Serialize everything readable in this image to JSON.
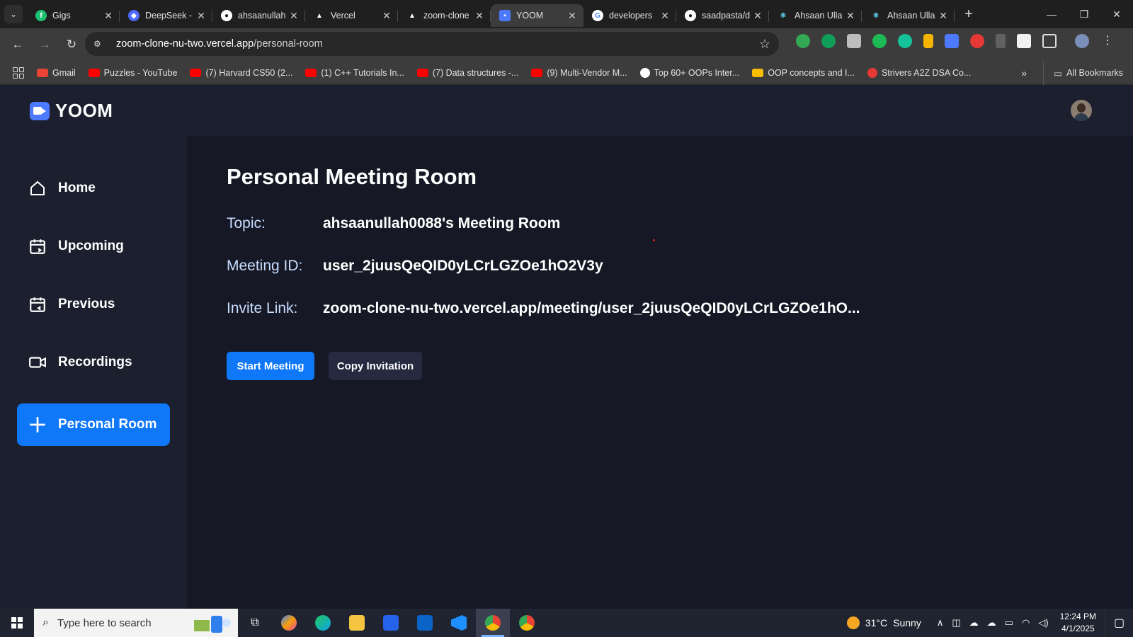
{
  "browser": {
    "tabs": [
      {
        "title": "Gigs",
        "icon": "fiverr-icon",
        "color": "#1dbf73"
      },
      {
        "title": "DeepSeek -",
        "icon": "deepseek-icon",
        "color": "#4d6bfe"
      },
      {
        "title": "ahsaanullah",
        "icon": "github-icon",
        "color": "#ffffff"
      },
      {
        "title": "Vercel",
        "icon": "vercel-icon",
        "color": "#ffffff"
      },
      {
        "title": "zoom-clone",
        "icon": "vercel-icon",
        "color": "#ffffff"
      },
      {
        "title": "YOOM",
        "icon": "yoom-icon",
        "color": "#4d79ff"
      },
      {
        "title": "developers",
        "icon": "google-icon",
        "color": "#ffffff"
      },
      {
        "title": "saadpasta/d",
        "icon": "github-icon",
        "color": "#ffffff"
      },
      {
        "title": "Ahsaan Ulla",
        "icon": "react-icon",
        "color": "#61dafb"
      },
      {
        "title": "Ahsaan Ulla",
        "icon": "react-icon",
        "color": "#61dafb"
      }
    ],
    "url_host": "zoom-clone-nu-two.vercel.app",
    "url_path": "/personal-room",
    "bookmarks": [
      {
        "label": "Gmail",
        "color": "#ea4335"
      },
      {
        "label": "Puzzles - YouTube",
        "color": "#ff0000"
      },
      {
        "label": "(7) Harvard CS50 (2...",
        "color": "#ff0000"
      },
      {
        "label": "(1) C++ Tutorials In...",
        "color": "#ff0000"
      },
      {
        "label": "(7) Data structures -...",
        "color": "#ff0000"
      },
      {
        "label": "(9) Multi-Vendor M...",
        "color": "#ff0000"
      },
      {
        "label": "Top 60+ OOPs Inter...",
        "color": "#ffffff"
      },
      {
        "label": "OOP concepts and I...",
        "color": "#fbbc04"
      },
      {
        "label": "Strivers A2Z DSA Co...",
        "color": "#e53935"
      }
    ],
    "all_bookmarks": "All Bookmarks"
  },
  "app": {
    "logo_text": "YOOM",
    "sidebar": [
      {
        "label": "Home",
        "icon": "home-icon"
      },
      {
        "label": "Upcoming",
        "icon": "calendar-upcoming-icon"
      },
      {
        "label": "Previous",
        "icon": "calendar-previous-icon"
      },
      {
        "label": "Recordings",
        "icon": "video-icon"
      },
      {
        "label": "Personal Room",
        "icon": "plus-icon",
        "active": true
      }
    ],
    "page_title": "Personal Meeting Room",
    "details": [
      {
        "label": "Topic:",
        "value": "ahsaanullah0088's Meeting Room"
      },
      {
        "label": "Meeting ID:",
        "value": "user_2juusQeQID0yLCrLGZOe1hO2V3y"
      },
      {
        "label": "Invite Link:",
        "value": "zoom-clone-nu-two.vercel.app/meeting/user_2juusQeQID0yLCrLGZOe1hO..."
      }
    ],
    "start_button": "Start Meeting",
    "copy_button": "Copy Invitation",
    "accent_color": "#0e78f9"
  },
  "taskbar": {
    "search_placeholder": "Type here to search",
    "weather_temp": "31°C",
    "weather_desc": "Sunny",
    "time": "12:24 PM",
    "date": "4/1/2025"
  }
}
